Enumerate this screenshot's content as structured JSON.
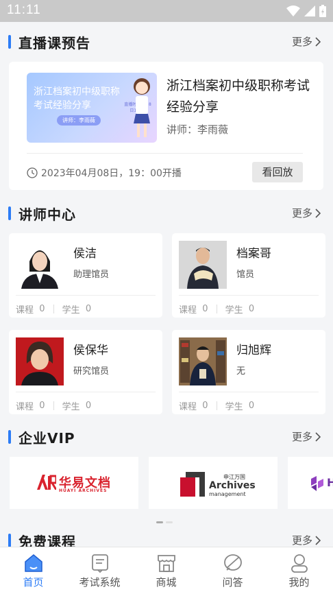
{
  "status_bar": {
    "time": "11:11"
  },
  "live": {
    "section_title": "直播课预告",
    "more": "更多",
    "thumb_text": "浙江档案初中级职称考试经验分享",
    "thumb_speaker": "讲师：李雨薇",
    "thumb_badge": "直播时间 4月8日19:00",
    "title": "浙江档案初中级职称考试经验分享",
    "teacher": "讲师：李雨薇",
    "time": "2023年04月08日，19：00开播",
    "replay_label": "看回放"
  },
  "teachers": {
    "section_title": "讲师中心",
    "more": "更多",
    "items": [
      {
        "name": "侯洁",
        "role": "助理馆员",
        "courses_label": "课程",
        "courses": "0",
        "students_label": "学生",
        "students": "0"
      },
      {
        "name": "档案哥",
        "role": "馆员",
        "courses_label": "课程",
        "courses": "0",
        "students_label": "学生",
        "students": "0"
      },
      {
        "name": "侯保华",
        "role": "研究馆员",
        "courses_label": "课程",
        "courses": "0",
        "students_label": "学生",
        "students": "0"
      },
      {
        "name": "归旭辉",
        "role": "无",
        "courses_label": "课程",
        "courses": "0",
        "students_label": "学生",
        "students": "0"
      }
    ]
  },
  "vip": {
    "section_title": "企业VIP",
    "more": "更多",
    "logos": [
      {
        "cn": "华易文档",
        "en": "HUAYI ARCHIVES"
      },
      {
        "cn": "申江万国",
        "en": "Archives",
        "en2": "management"
      },
      {
        "cn": "H"
      }
    ]
  },
  "free": {
    "section_title": "免费课程",
    "more": "更多"
  },
  "tabs": [
    {
      "label": "首页",
      "icon": "home-icon"
    },
    {
      "label": "考试系统",
      "icon": "exam-icon"
    },
    {
      "label": "商城",
      "icon": "shop-icon"
    },
    {
      "label": "问答",
      "icon": "qa-icon"
    },
    {
      "label": "我的",
      "icon": "profile-icon"
    }
  ],
  "colors": {
    "accent": "#2c7cf6",
    "brand_red": "#d9232e"
  }
}
